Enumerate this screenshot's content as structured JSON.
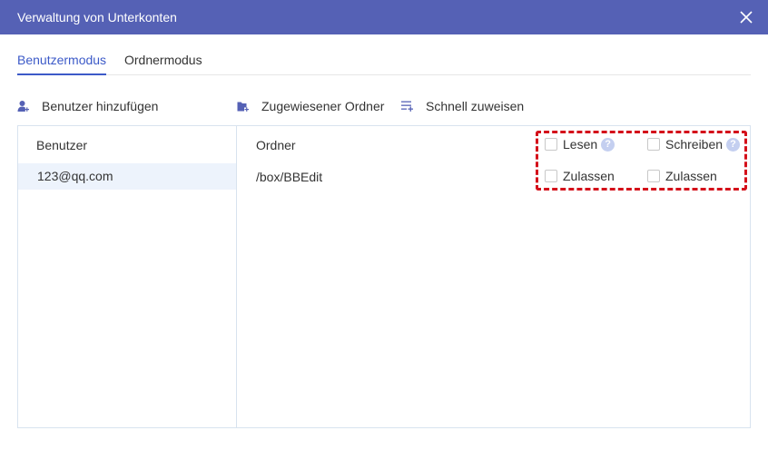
{
  "dialog": {
    "title": "Verwaltung von Unterkonten",
    "title_bar_color": "#5561b5"
  },
  "tabs": [
    {
      "label": "Benutzermodus",
      "active": true
    },
    {
      "label": "Ordnermodus",
      "active": false
    }
  ],
  "toolbar": {
    "add_user": "Benutzer hinzufügen",
    "assigned_folder": "Zugewiesener Ordner",
    "quick_assign": "Schnell zuweisen"
  },
  "users": {
    "header": "Benutzer",
    "items": [
      "123@qq.com"
    ]
  },
  "folders": {
    "header": "Ordner",
    "rows": [
      {
        "path": "/box/BBEdit"
      }
    ]
  },
  "permissions": {
    "read": {
      "label": "Lesen",
      "checked": false
    },
    "write": {
      "label": "Schreiben",
      "checked": false
    },
    "allow_read": {
      "label": "Zulassen",
      "checked": false
    },
    "allow_write": {
      "label": "Zulassen",
      "checked": false
    },
    "help_glyph": "?"
  },
  "colors": {
    "accent": "#3c5ac8",
    "highlight": "#d4101a",
    "selected_row": "#edf3fc"
  }
}
